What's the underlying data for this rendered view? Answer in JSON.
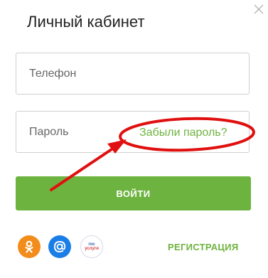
{
  "modal": {
    "title": "Личный кабинет"
  },
  "form": {
    "phone_placeholder": "Телефон",
    "password_placeholder": "Пароль",
    "forgot_password_label": "Забыли пароль?",
    "login_label": "ВОЙТИ"
  },
  "social": {
    "items": [
      {
        "name": "odnoklassniki",
        "icon": "odnoklassniki-icon",
        "color": "#f28c1b"
      },
      {
        "name": "mail",
        "icon": "at-sign-icon",
        "color": "#1a7ee6"
      },
      {
        "name": "gosuslugi",
        "icon": "gosuslugi-icon",
        "color": "#2d5aa8",
        "text_line1": "гос",
        "text_line2": "услуги"
      }
    ]
  },
  "footer": {
    "register_label": "РЕГИСТРАЦИЯ"
  },
  "annotation": {
    "color": "#e01010",
    "shape": "ellipse-with-arrow"
  },
  "colors": {
    "accent_green": "#6db33f",
    "link_green": "#6fb33f"
  }
}
